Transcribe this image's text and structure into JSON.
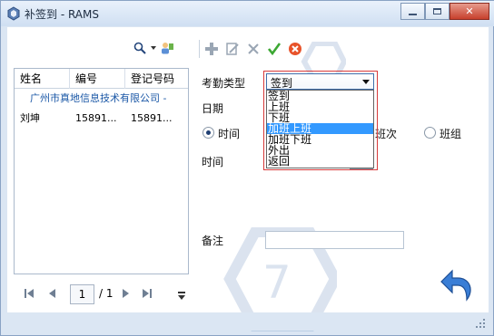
{
  "window": {
    "title": "补签到 - RAMS",
    "minimize": "▭",
    "maximize": "▭",
    "close": "✕"
  },
  "left": {
    "search": {
      "value": "",
      "placeholder": ""
    },
    "grid": {
      "columns": [
        "姓名",
        "编号",
        "登记号码"
      ],
      "group": "广州市真地信息技术有限公司 -",
      "rows": [
        {
          "name": "刘坤",
          "id": "15891...",
          "reg": "15891..."
        }
      ]
    },
    "pager": {
      "page": "1",
      "total": "/ 1"
    }
  },
  "form": {
    "type_label": "考勤类型",
    "date_label": "日期",
    "radio_time": "时间",
    "radio_shift_partial": "班次",
    "radio_group": "班组",
    "time_label": "时间",
    "remark_label": "备注",
    "select_value": "签到",
    "options": [
      "签到",
      "上班",
      "下班",
      "加班上班",
      "加班下班",
      "外出",
      "返回"
    ],
    "selected_option": "加班上班"
  },
  "colors": {
    "accent": "#3399ff",
    "highlight_border": "#d83a3a",
    "group_text": "#1a57a6"
  }
}
